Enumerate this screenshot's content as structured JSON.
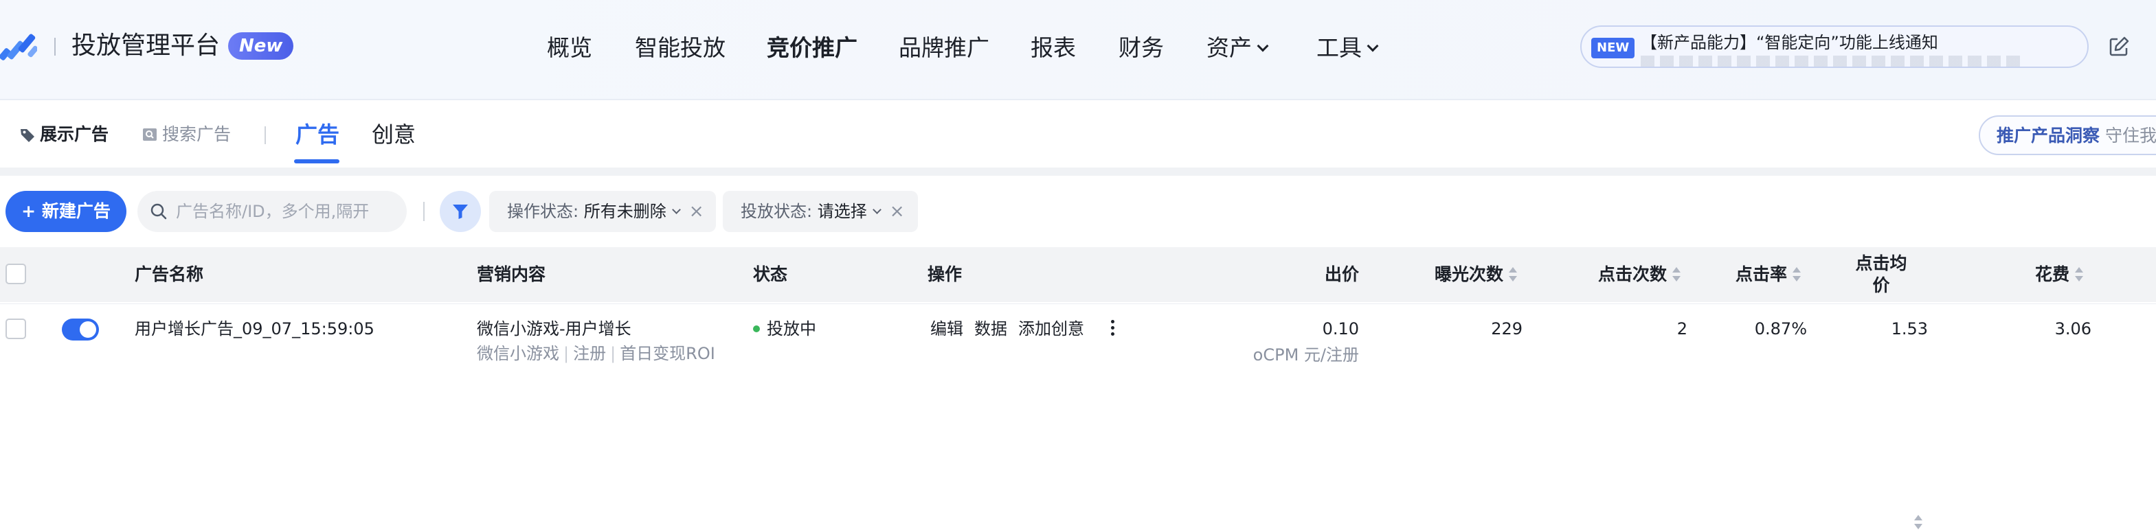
{
  "header": {
    "app_title": "投放管理平台",
    "new_badge": "New",
    "nav": [
      {
        "label": "概览",
        "active": false
      },
      {
        "label": "智能投放",
        "active": false
      },
      {
        "label": "竞价推广",
        "active": true
      },
      {
        "label": "品牌推广",
        "active": false
      },
      {
        "label": "报表",
        "active": false
      },
      {
        "label": "财务",
        "active": false
      },
      {
        "label": "资产",
        "active": false,
        "dropdown": true
      },
      {
        "label": "工具",
        "active": false,
        "dropdown": true
      }
    ],
    "notice": {
      "badge": "NEW",
      "text": "【新产品能力】“智能定向”功能上线通知"
    },
    "icons": {
      "logo": "logo-icon",
      "edit": "edit-icon"
    }
  },
  "subbar": {
    "ad_types": [
      {
        "label": "展示广告",
        "active": true,
        "icon": "tag-icon"
      },
      {
        "label": "搜索广告",
        "active": false,
        "icon": "search-ad-icon"
      }
    ],
    "tabs": [
      {
        "label": "广告",
        "active": true
      },
      {
        "label": "创意",
        "active": false
      }
    ],
    "insight_button": {
      "label": "推广产品洞察",
      "hint": "守住我的"
    }
  },
  "toolbar": {
    "new_button": "+ 新建广告",
    "search_placeholder": "广告名称/ID，多个用,隔开",
    "filter_icon": "filter-icon",
    "chips": [
      {
        "key": "操作状态: ",
        "value": "所有未删除"
      },
      {
        "key": "投放状态: ",
        "value": "请选择"
      }
    ]
  },
  "table": {
    "headers": {
      "name": "广告名称",
      "content": "营销内容",
      "status": "状态",
      "actions": "操作",
      "bid": "出价",
      "impressions": "曝光次数",
      "clicks": "点击次数",
      "ctr": "点击率",
      "cpc_line1": "点击均",
      "cpc_line2": "价",
      "cost": "花费"
    },
    "rows": [
      {
        "enabled": true,
        "name": "用户增长广告_09_07_15:59:05",
        "content": "微信小游戏-用户增长",
        "content_tags": [
          "微信小游戏",
          "注册",
          "首日变现ROI"
        ],
        "status": "投放中",
        "status_color": "#3ab75b",
        "actions": [
          "编辑",
          "数据",
          "添加创意"
        ],
        "bid": "0.10",
        "bid_unit": "oCPM 元/注册",
        "impressions": "229",
        "clicks": "2",
        "ctr": "0.87%",
        "cpc": "1.53",
        "cost": "3.06"
      }
    ]
  },
  "colors": {
    "accent": "#2f6bf0",
    "status_green": "#3ab75b"
  }
}
